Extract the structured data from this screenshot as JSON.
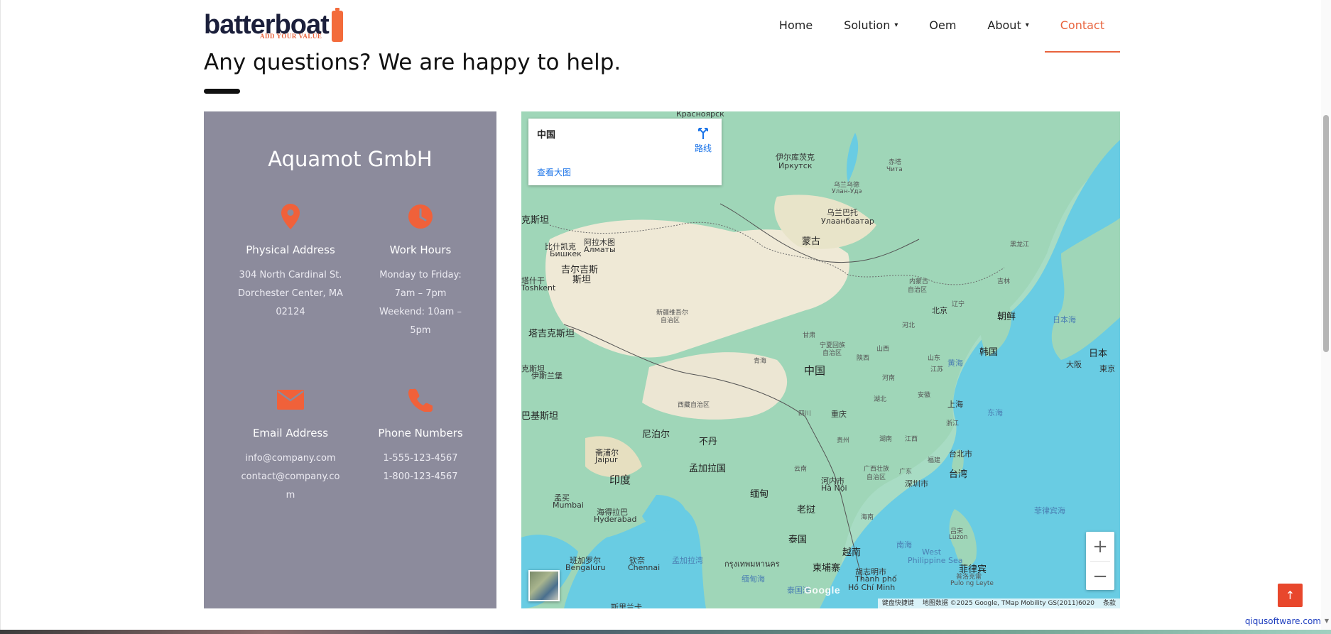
{
  "header": {
    "logo_text": "batterboat",
    "logo_tagline": "ADD YOUR VALUE",
    "nav": [
      {
        "label": "Home",
        "has_dropdown": false,
        "active": false
      },
      {
        "label": "Solution",
        "has_dropdown": true,
        "active": false
      },
      {
        "label": "Oem",
        "has_dropdown": false,
        "active": false
      },
      {
        "label": "About",
        "has_dropdown": true,
        "active": false
      },
      {
        "label": "Contact",
        "has_dropdown": false,
        "active": true
      }
    ]
  },
  "page": {
    "heading": "Any questions? We are happy to help."
  },
  "contact": {
    "company": "Aquamot GmbH",
    "address": {
      "icon": "location-pin-icon",
      "title": "Physical Address",
      "lines": [
        "304 North Cardinal St.",
        "Dorchester Center, MA",
        "02124"
      ]
    },
    "hours": {
      "icon": "clock-icon",
      "title": "Work Hours",
      "lines": [
        "Monday to Friday:",
        "7am – 7pm",
        "Weekend: 10am –",
        "5pm"
      ]
    },
    "email": {
      "icon": "envelope-icon",
      "title": "Email Address",
      "lines": [
        "info@company.com",
        "contact@company.co",
        "m"
      ]
    },
    "phone": {
      "icon": "phone-icon",
      "title": "Phone Numbers",
      "lines": [
        "1-555-123-4567",
        "1-800-123-4567"
      ]
    },
    "accent_color": "#e8633d"
  },
  "map": {
    "place_name": "中国",
    "directions_label": "路线",
    "view_larger": "查看大图",
    "zoom_in": "+",
    "zoom_out": "−",
    "attribution": {
      "shortcuts": "键盘快捷键",
      "data": "地图数据 ©2025 Google, TMap Mobility GS(2011)6020",
      "terms": "条款"
    },
    "google_logo": "Google",
    "labels": [
      {
        "text": "Красноярск",
        "cls": ""
      },
      {
        "text": "伊尔库茨克",
        "cls": ""
      },
      {
        "text": "Иркутск",
        "cls": ""
      },
      {
        "text": "赤塔",
        "cls": "small"
      },
      {
        "text": "Чита",
        "cls": "small"
      },
      {
        "text": "乌兰乌德",
        "cls": "small"
      },
      {
        "text": "Улан-Удэ",
        "cls": "small"
      },
      {
        "text": "乌兰巴托",
        "cls": ""
      },
      {
        "text": "Улаанбаатар",
        "cls": ""
      },
      {
        "text": "蒙古",
        "cls": "mid"
      },
      {
        "text": "黑龙江",
        "cls": "small"
      },
      {
        "text": "吉林",
        "cls": "small"
      },
      {
        "text": "内蒙古",
        "cls": "small"
      },
      {
        "text": "自治区",
        "cls": "small"
      },
      {
        "text": "辽宁",
        "cls": "small"
      },
      {
        "text": "北京",
        "cls": ""
      },
      {
        "text": "朝鲜",
        "cls": "mid"
      },
      {
        "text": "日本海",
        "cls": "sea"
      },
      {
        "text": "韩国",
        "cls": "mid"
      },
      {
        "text": "日本",
        "cls": "mid"
      },
      {
        "text": "大阪",
        "cls": ""
      },
      {
        "text": "東京",
        "cls": ""
      },
      {
        "text": "黄海",
        "cls": "sea"
      },
      {
        "text": "河北",
        "cls": "small"
      },
      {
        "text": "山西",
        "cls": "small"
      },
      {
        "text": "山东",
        "cls": "small"
      },
      {
        "text": "宁夏回族",
        "cls": "small"
      },
      {
        "text": "自治区",
        "cls": "small"
      },
      {
        "text": "甘肃",
        "cls": "small"
      },
      {
        "text": "陕西",
        "cls": "small"
      },
      {
        "text": "河南",
        "cls": "small"
      },
      {
        "text": "中国",
        "cls": "big"
      },
      {
        "text": "青海",
        "cls": "small"
      },
      {
        "text": "江苏",
        "cls": "small"
      },
      {
        "text": "安徽",
        "cls": "small"
      },
      {
        "text": "湖北",
        "cls": "small"
      },
      {
        "text": "上海",
        "cls": ""
      },
      {
        "text": "东海",
        "cls": "sea"
      },
      {
        "text": "浙江",
        "cls": "small"
      },
      {
        "text": "四川",
        "cls": "small"
      },
      {
        "text": "重庆",
        "cls": ""
      },
      {
        "text": "湖南",
        "cls": "small"
      },
      {
        "text": "江西",
        "cls": "small"
      },
      {
        "text": "福建",
        "cls": "small"
      },
      {
        "text": "贵州",
        "cls": "small"
      },
      {
        "text": "台北市",
        "cls": ""
      },
      {
        "text": "台湾",
        "cls": "mid"
      },
      {
        "text": "西藏自治区",
        "cls": "small"
      },
      {
        "text": "云南",
        "cls": "small"
      },
      {
        "text": "广西壮族",
        "cls": "small"
      },
      {
        "text": "自治区",
        "cls": "small"
      },
      {
        "text": "广东",
        "cls": "small"
      },
      {
        "text": "深圳市",
        "cls": ""
      },
      {
        "text": "河内市",
        "cls": ""
      },
      {
        "text": "Hà Nội",
        "cls": ""
      },
      {
        "text": "新疆维吾尔",
        "cls": "small"
      },
      {
        "text": "自治区",
        "cls": "small"
      },
      {
        "text": "比什凯克",
        "cls": ""
      },
      {
        "text": "Бишкек",
        "cls": ""
      },
      {
        "text": "阿拉木图",
        "cls": ""
      },
      {
        "text": "Алматы",
        "cls": ""
      },
      {
        "text": "吉尔吉斯",
        "cls": "mid"
      },
      {
        "text": "斯坦",
        "cls": "mid"
      },
      {
        "text": "塔什干",
        "cls": ""
      },
      {
        "text": "Toshkent",
        "cls": ""
      },
      {
        "text": "塔吉克斯坦",
        "cls": "mid"
      },
      {
        "text": "克斯坦",
        "cls": "mid"
      },
      {
        "text": "伊斯兰堡",
        "cls": ""
      },
      {
        "text": "巴基斯坦",
        "cls": "mid"
      },
      {
        "text": "尼泊尔",
        "cls": "mid"
      },
      {
        "text": "不丹",
        "cls": "mid"
      },
      {
        "text": "斋浦尔",
        "cls": ""
      },
      {
        "text": "Jaipur",
        "cls": ""
      },
      {
        "text": "孟加拉国",
        "cls": "mid"
      },
      {
        "text": "印度",
        "cls": "big"
      },
      {
        "text": "缅甸",
        "cls": "mid"
      },
      {
        "text": "老挝",
        "cls": "mid"
      },
      {
        "text": "孟买",
        "cls": ""
      },
      {
        "text": "Mumbai",
        "cls": ""
      },
      {
        "text": "海得拉巴",
        "cls": ""
      },
      {
        "text": "Hyderabad",
        "cls": ""
      },
      {
        "text": "泰国",
        "cls": "mid"
      },
      {
        "text": "越南",
        "cls": "mid"
      },
      {
        "text": "海南",
        "cls": "small"
      },
      {
        "text": "菲律宾海",
        "cls": "sea"
      },
      {
        "text": "南海",
        "cls": "sea"
      },
      {
        "text": "West",
        "cls": "sea"
      },
      {
        "text": "Philippine Sea",
        "cls": "sea"
      },
      {
        "text": "吕宋",
        "cls": "small"
      },
      {
        "text": "Luzon",
        "cls": "small"
      },
      {
        "text": "班加罗尔",
        "cls": ""
      },
      {
        "text": "Bengaluru",
        "cls": ""
      },
      {
        "text": "钦奈",
        "cls": ""
      },
      {
        "text": "Chennai",
        "cls": ""
      },
      {
        "text": "孟加拉湾",
        "cls": "sea"
      },
      {
        "text": "กรุงเทพมหานคร",
        "cls": ""
      },
      {
        "text": "柬埔寨",
        "cls": "mid"
      },
      {
        "text": "胡志明市",
        "cls": ""
      },
      {
        "text": "Thành phố",
        "cls": ""
      },
      {
        "text": "Hồ Chí Minh",
        "cls": ""
      },
      {
        "text": "菲律宾",
        "cls": "mid"
      },
      {
        "text": "普洛克雷",
        "cls": "small"
      },
      {
        "text": "Pulo ng Leyte",
        "cls": "small"
      },
      {
        "text": "缅甸海",
        "cls": "sea"
      },
      {
        "text": "泰国湾",
        "cls": "sea"
      },
      {
        "text": "斯里兰卡",
        "cls": ""
      },
      {
        "text": "克斯坦",
        "cls": ""
      }
    ]
  },
  "watermark": "qiqusoftware.com",
  "back_to_top": "↑"
}
